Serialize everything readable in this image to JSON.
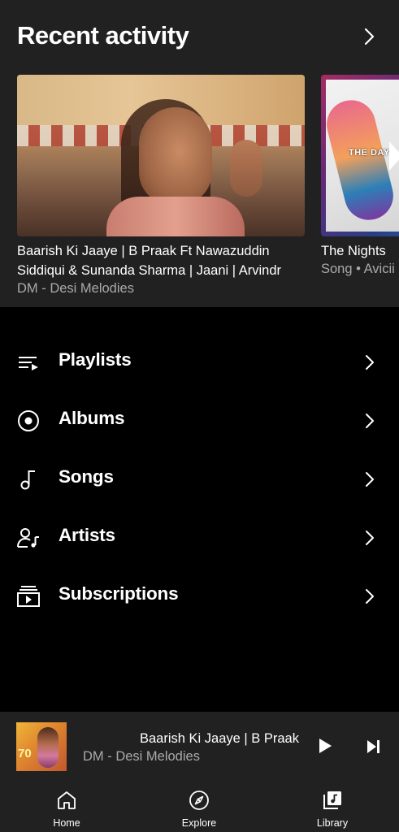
{
  "recent": {
    "title": "Recent activity",
    "cards": [
      {
        "title": "Baarish Ki Jaaye | B Praak Ft Nawazuddin Siddiqui & Sunanda Sharma | Jaani | Arvindr Khaira | Desi Melodies",
        "subtitle": "DM - Desi Melodies"
      },
      {
        "title": "The Nights",
        "subtitle": "Song • Avicii",
        "art_text": "THE DAYS"
      }
    ]
  },
  "menu": {
    "items": [
      {
        "label": "Playlists",
        "icon": "playlist-icon"
      },
      {
        "label": "Albums",
        "icon": "album-icon"
      },
      {
        "label": "Songs",
        "icon": "music-note-icon"
      },
      {
        "label": "Artists",
        "icon": "artist-icon"
      },
      {
        "label": "Subscriptions",
        "icon": "subscriptions-icon"
      }
    ]
  },
  "mini_player": {
    "title": "Baarish Ki Jaaye | B Praak Ft Nawazuddin Siddiqui",
    "artist": "DM - Desi Melodies",
    "art_text": "70"
  },
  "nav": {
    "items": [
      {
        "label": "Home",
        "icon": "home-icon"
      },
      {
        "label": "Explore",
        "icon": "compass-icon"
      },
      {
        "label": "Library",
        "icon": "library-icon",
        "active": true
      }
    ]
  },
  "colors": {
    "background": "#000000",
    "surface": "#212121",
    "text_primary": "#ffffff",
    "text_secondary": "#aaaaaa"
  }
}
